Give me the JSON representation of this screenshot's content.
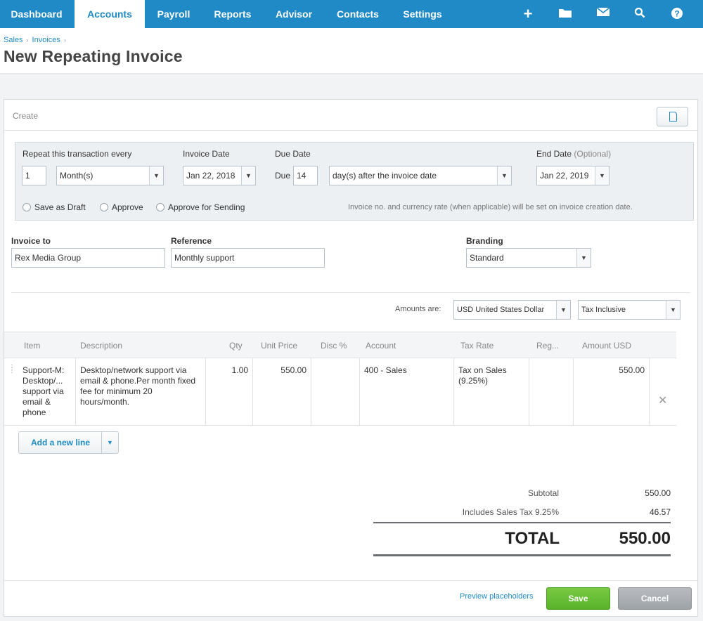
{
  "nav": {
    "tabs": [
      {
        "label": "Dashboard"
      },
      {
        "label": "Accounts"
      },
      {
        "label": "Payroll"
      },
      {
        "label": "Reports"
      },
      {
        "label": "Advisor"
      },
      {
        "label": "Contacts"
      },
      {
        "label": "Settings"
      }
    ],
    "active_tab": "Accounts",
    "icons": [
      "plus-icon",
      "folder-icon",
      "mail-icon",
      "search-icon",
      "help-icon"
    ]
  },
  "breadcrumb": [
    "Sales",
    "Invoices"
  ],
  "page_title": "New Repeating Invoice",
  "panel": {
    "label": "Create"
  },
  "repeat": {
    "label": "Repeat this transaction every",
    "every_value": "1",
    "period": "Month(s)",
    "invoice_date_label": "Invoice Date",
    "invoice_date": "Jan 22, 2018",
    "due_date_label": "Due Date",
    "due_prefix": "Due",
    "due_value": "14",
    "due_terms": "day(s) after the invoice date",
    "end_date_label": "End Date",
    "end_date_optional": "(Optional)",
    "end_date": "Jan 22, 2019",
    "options": [
      "Save as Draft",
      "Approve",
      "Approve for Sending"
    ],
    "note": "Invoice no. and currency rate (when applicable) will be set on invoice creation date."
  },
  "fields": {
    "invoice_to_label": "Invoice to",
    "invoice_to": "Rex Media Group",
    "reference_label": "Reference",
    "reference": "Monthly support",
    "branding_label": "Branding",
    "branding": "Standard"
  },
  "amounts": {
    "label": "Amounts are:",
    "currency": "USD United States Dollar",
    "tax_mode": "Tax Inclusive"
  },
  "table": {
    "columns": [
      "Item",
      "Description",
      "Qty",
      "Unit Price",
      "Disc %",
      "Account",
      "Tax Rate",
      "Reg...",
      "Amount USD"
    ],
    "rows": [
      {
        "item": "Support-M: Desktop/... support via email & phone",
        "description": "Desktop/network support via email & phone.Per month fixed fee for minimum 20 hours/month.",
        "qty": "1.00",
        "unit_price": "550.00",
        "disc": "",
        "account": "400 - Sales",
        "tax_rate": "Tax on Sales (9.25%)",
        "region": "",
        "amount": "550.00"
      }
    ],
    "add_line_label": "Add a new line"
  },
  "totals": {
    "subtotal_label": "Subtotal",
    "subtotal": "550.00",
    "tax_label": "Includes Sales Tax 9.25%",
    "tax": "46.57",
    "total_label": "TOTAL",
    "total": "550.00"
  },
  "footer": {
    "preview_label": "Preview placeholders",
    "save_label": "Save",
    "cancel_label": "Cancel"
  },
  "colors": {
    "brand": "#1f8ac6",
    "save": "#6abf37",
    "cancel": "#a9adb1"
  }
}
